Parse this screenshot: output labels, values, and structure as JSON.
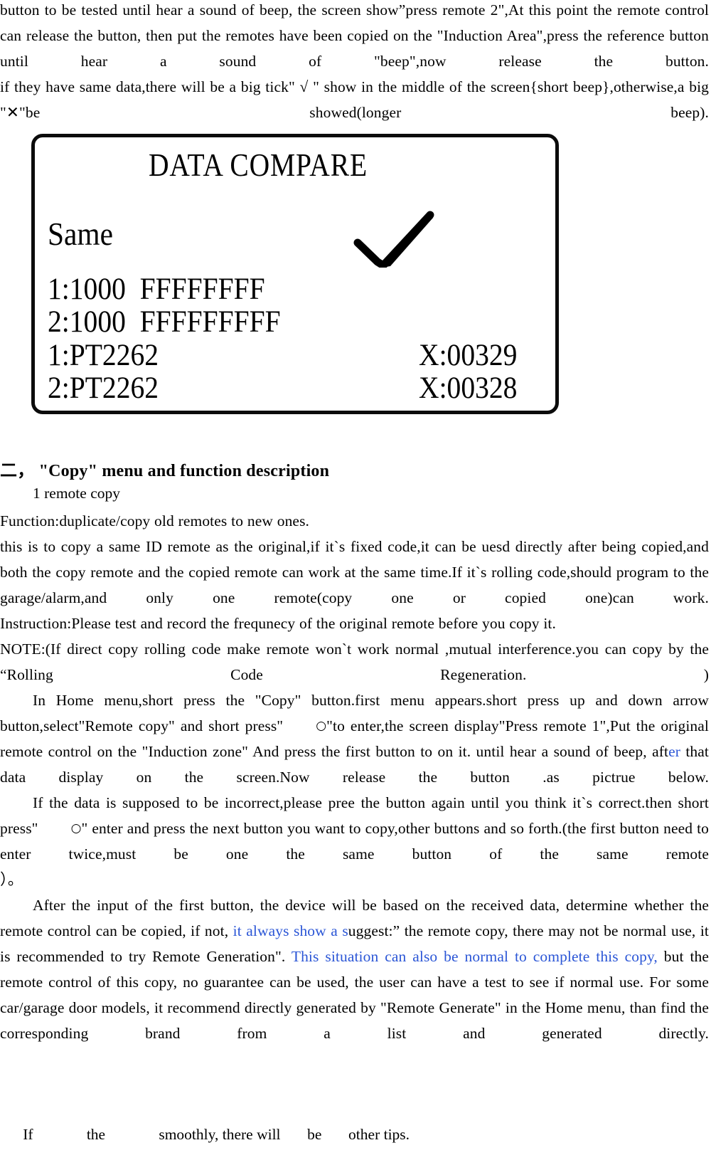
{
  "document": {
    "top_paragraphs": [
      "button to be tested until hear a sound of beep, the screen show”press remote 2\",At this point the remote control can release the button, then put the remotes have been copied on the \"Induction Area\",press the reference button until hear a sound of \"beep\",now release the button.",
      "if they have same data,there will be a big tick\" √ \" show in the middle of the screen{short beep},otherwise,a big \"✕\"be showed(longer beep)."
    ],
    "section": {
      "heading": "二， \"Copy\" menu and function description",
      "sub_item": "1 remote copy",
      "function_line": "Function:duplicate/copy old remotes to new ones.",
      "paragraph_fixed_code": "this is to copy a same ID remote as the original,if it`s fixed code,it can be uesd directly after being copied,and both the copy remote and the copied remote can work at the same time.If it`s rolling code,should program to the garage/alarm,and only one remote(copy one or copied one)can work.",
      "instruction_line": "Instruction:Please test and record the frequnecy of the original remote before you copy it.",
      "note_paragraph": "NOTE:(If direct copy rolling code make remote won`t work normal ,mutual interference.you can copy by the “Rolling Code Regeneration. )",
      "home_menu_paragraph_part1": "In Home menu,short press the \"Copy\" button.first menu appears.short press up and down arrow button,select\"Remote copy\" and short press\"",
      "home_menu_circle": "○",
      "home_menu_paragraph_part2": "\"to enter,the screen display\"Press remote 1\",Put the original remote control on the \"Induction zone\" And press the first button to on it. until hear a sound of beep, ",
      "home_menu_after_black": "aft",
      "home_menu_after_blue": "er",
      "home_menu_paragraph_part3": " that data display on the screen.Now release the button .as pictrue below.",
      "incorrect_paragraph_part1": "If the data is supposed to be incorrect,please pree the button again until you think it`s correct.then short press\"",
      "incorrect_circle": "○",
      "incorrect_paragraph_part2": "\" enter and press the next button you want to copy,other buttons and so forth.(the first button need to enter twice,must be one the same button of the same remote",
      "closing_paren": "）。",
      "after_input_part1": "After the input of the first button, the device will be based on the received data, determine whether the remote control can be copied, if not, ",
      "after_input_blue1": "it always show a s",
      "after_input_part2": "uggest:” the remote copy, there may not be normal use, it is recommended to try Remote Generation\". ",
      "after_input_blue2": "This situation can also be normal to complete this copy,",
      "after_input_part3": " but the remote control of this copy, no guarantee can be used, the user can have a test to see if normal use. For some car/garage door models, it recommend directly generated by \"Remote Generate\" in the Home menu, than find the corresponding brand from a list and generated directly.",
      "tip_line": "      If              the              smoothly, there will       be       other tips."
    },
    "lcd_screen": {
      "title": "DATA  COMPARE",
      "status": "Same",
      "check_icon": "check-mark",
      "rows": [
        "1:1000  FFFFFFFF",
        "2:1000  FFFFFFFFF",
        "1:PT2262",
        "2:PT2262"
      ],
      "x_values": [
        "X:00329",
        "X:00328"
      ]
    },
    "colors": {
      "text": "#000000",
      "highlight_blue": "#2b56d6",
      "lcd_border": "#0b0b0b",
      "background": "#ffffff"
    }
  }
}
